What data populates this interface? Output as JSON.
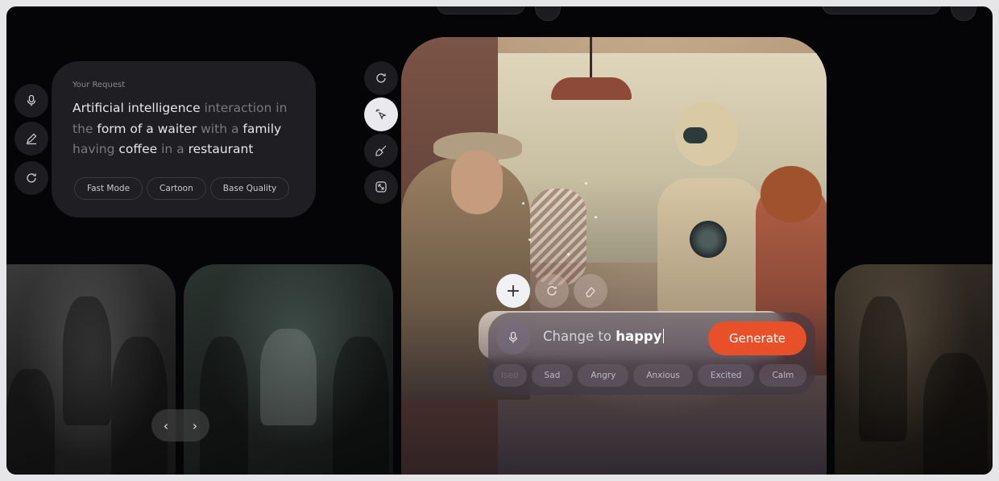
{
  "request": {
    "label": "Your Request",
    "text_parts": [
      {
        "t": "Artificial intelligence",
        "hl": true
      },
      {
        "t": " interaction in ",
        "hl": false
      },
      {
        "t": "the",
        "hl": false
      },
      {
        "t": " form of a waiter",
        "hl": true
      },
      {
        "t": " with a ",
        "hl": false
      },
      {
        "t": "family",
        "hl": true
      },
      {
        "t": " having ",
        "hl": false
      },
      {
        "t": "coffee",
        "hl": true
      },
      {
        "t": " in a ",
        "hl": false
      },
      {
        "t": "restaurant",
        "hl": true
      }
    ],
    "chips": [
      "Fast Mode",
      "Cartoon",
      "Base Quality"
    ]
  },
  "side_tools": [
    "mic-icon",
    "pencil-icon",
    "refresh-icon"
  ],
  "image_tools": [
    "refresh-icon",
    "magic-select-icon",
    "brush-icon",
    "resize-icon"
  ],
  "prompt": {
    "prefix": "Change to ",
    "bold": "happy",
    "generate_label": "Generate"
  },
  "moods": [
    "ised",
    "Sad",
    "Angry",
    "Anxious",
    "Excited",
    "Calm"
  ],
  "gallery_nav": {
    "prev": "‹",
    "next": "›"
  },
  "colors": {
    "accent": "#e8502a",
    "background": "#050507",
    "card": "#1e1e23"
  }
}
